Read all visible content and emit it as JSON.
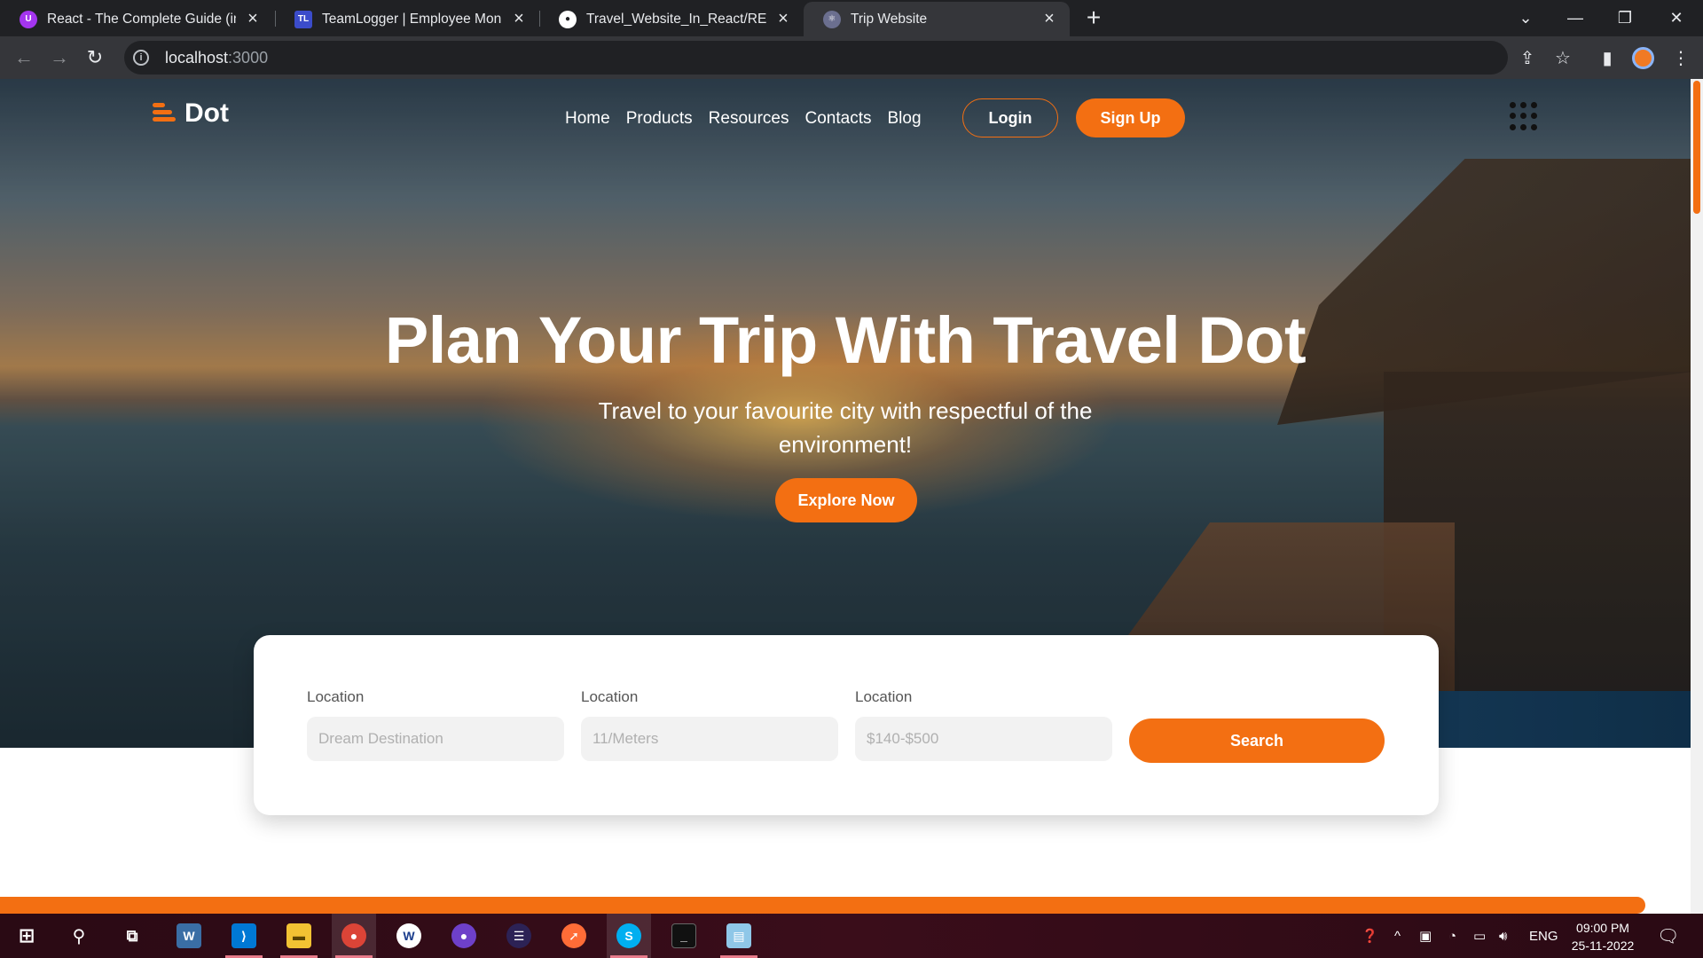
{
  "browser": {
    "tabs": [
      {
        "title": "React - The Complete Guide (incl",
        "icon": "udemy-icon",
        "color": "#a435f0"
      },
      {
        "title": "TeamLogger | Employee Monitori",
        "icon": "teamlogger-icon",
        "color": "#3b4cca"
      },
      {
        "title": "Travel_Website_In_React/READM",
        "icon": "github-icon",
        "color": "#ffffff"
      },
      {
        "title": "Trip Website",
        "icon": "react-icon",
        "color": "#6b6f8f"
      }
    ],
    "url_host": "localhost",
    "url_port": ":3000"
  },
  "site": {
    "logo_text": "Dot",
    "nav": [
      "Home",
      "Products",
      "Resources",
      "Contacts",
      "Blog"
    ],
    "login_label": "Login",
    "signup_label": "Sign Up",
    "hero_title": "Plan Your Trip With Travel Dot",
    "hero_subtitle": "Travel to your favourite city with respectful of the environment!",
    "explore_label": "Explore Now",
    "search": {
      "fields": [
        {
          "label": "Location",
          "placeholder": "Dream Destination"
        },
        {
          "label": "Location",
          "placeholder": "11/Meters"
        },
        {
          "label": "Location",
          "placeholder": "$140-$500"
        }
      ],
      "button_label": "Search"
    },
    "accent_color": "#f36f12"
  },
  "taskbar": {
    "apps": [
      "start-icon",
      "search-icon",
      "task-view-icon",
      "mysql-workbench-icon",
      "vscode-icon",
      "file-explorer-icon",
      "chrome-icon",
      "wordweb-icon",
      "github-desktop-icon",
      "eclipse-icon",
      "postman-icon",
      "skype-icon",
      "terminal-icon",
      "notepad-icon"
    ],
    "language": "ENG",
    "time": "09:00 PM",
    "date": "25-11-2022"
  }
}
